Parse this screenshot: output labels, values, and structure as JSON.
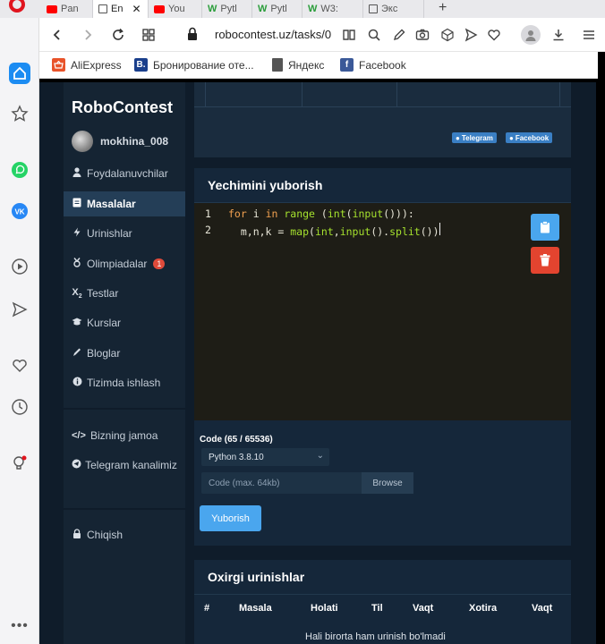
{
  "browser": {
    "tabs": [
      {
        "label": "Pan",
        "favicon": "youtube-icon"
      },
      {
        "label": "En",
        "favicon": "page-icon",
        "active": true
      },
      {
        "label": "You",
        "favicon": "youtube-icon"
      },
      {
        "label": "Pytl",
        "favicon": "w-icon"
      },
      {
        "label": "Pytl",
        "favicon": "w-icon"
      },
      {
        "label": "W3:",
        "favicon": "w-icon"
      },
      {
        "label": "Экс",
        "favicon": "page-icon"
      }
    ],
    "url": "robocontest.uz/tasks/0",
    "bookmarks": [
      {
        "label": "AliExpress",
        "icon": "aliexpress-icon",
        "color": "#e8532a"
      },
      {
        "label": "Бронирование оте...",
        "icon": "booking-icon",
        "color": "#1a3f8c"
      },
      {
        "label": "Яндекс",
        "icon": "bookmark-page-icon",
        "color": "#555555"
      },
      {
        "label": "Facebook",
        "icon": "facebook-icon",
        "color": "#3b5998"
      }
    ]
  },
  "site": {
    "brand": "RoboContest",
    "username": "mokhina_008",
    "nav": [
      {
        "label": "Foydalanuvchilar",
        "icon": "user-icon"
      },
      {
        "label": "Masalalar",
        "icon": "tasks-icon",
        "active": true
      },
      {
        "label": "Urinishlar",
        "icon": "attempts-icon"
      },
      {
        "label": "Olimpiadalar",
        "icon": "olympiad-icon",
        "badge": "1"
      },
      {
        "label": "Testlar",
        "icon": "tests-icon"
      },
      {
        "label": "Kurslar",
        "icon": "courses-icon"
      },
      {
        "label": "Bloglar",
        "icon": "blog-icon"
      },
      {
        "label": "Tizimda ishlash",
        "icon": "info-icon"
      }
    ],
    "nav_extra": [
      {
        "label": "Bizning jamoa",
        "icon": "code-icon"
      },
      {
        "label": "Telegram kanalimiz",
        "icon": "telegram-icon"
      }
    ],
    "logout": "Chiqish",
    "social": {
      "telegram": "Telegram",
      "facebook": "Facebook"
    },
    "submit": {
      "title": "Yechimini yuborish",
      "code_lines": [
        {
          "num": "1",
          "text": "for i in range (int(input())):"
        },
        {
          "num": "2",
          "text": "    m,n,k = map(int,input().split())"
        }
      ],
      "code_label": "Code (65 / 65536)",
      "language": "Python 3.8.10",
      "file_placeholder": "Code (max. 64kb)",
      "browse": "Browse",
      "submit_button": "Yuborish"
    },
    "attempts": {
      "title": "Oxirgi urinishlar",
      "columns": [
        "#",
        "Masala",
        "Holati",
        "Til",
        "Vaqt",
        "Xotira",
        "Vaqt"
      ],
      "empty": "Hali birorta ham urinish bo'lmadi"
    }
  }
}
